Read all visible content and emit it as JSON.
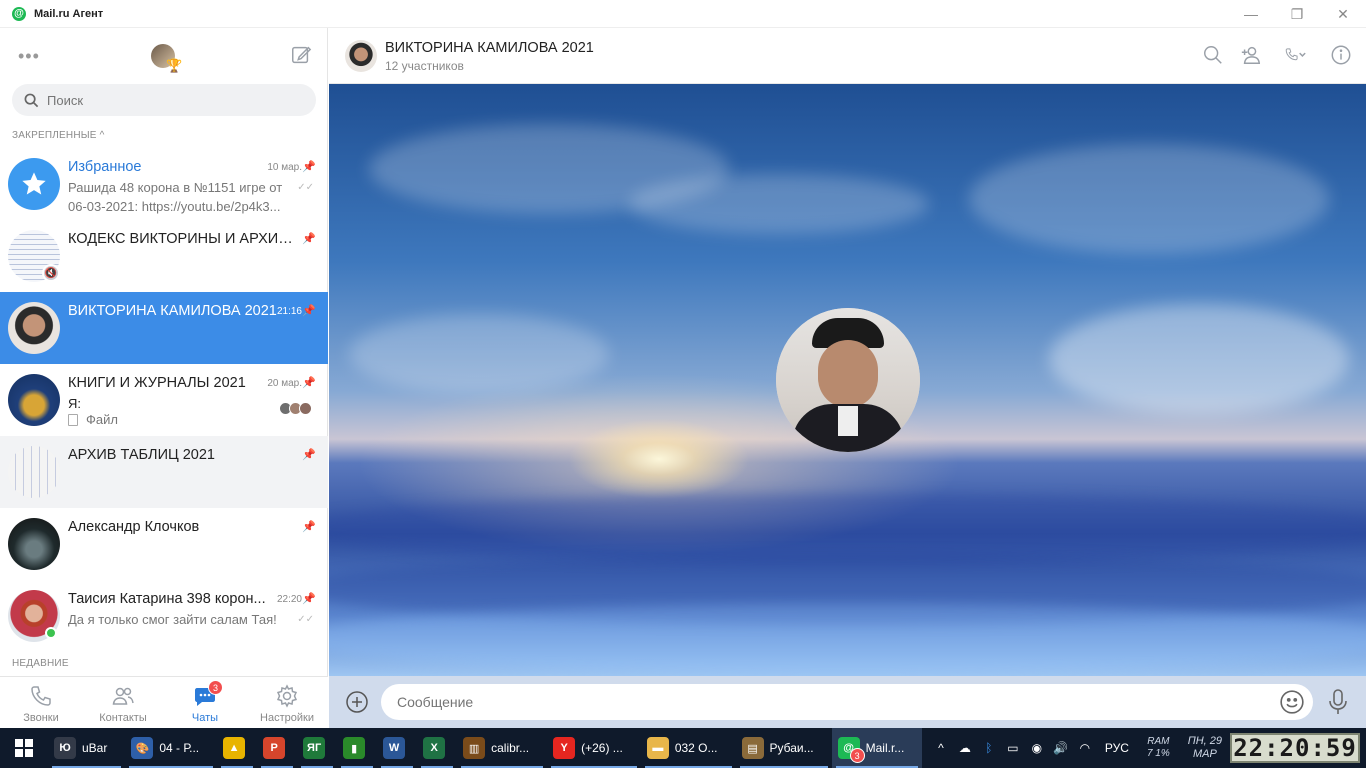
{
  "window": {
    "title": "Mail.ru Агент",
    "controls": [
      "minimize",
      "restore",
      "close"
    ]
  },
  "sidebar": {
    "search_placeholder": "Поиск",
    "pinned_label": "ЗАКРЕПЛЕННЫЕ",
    "recent_label": "НЕДАВНИЕ",
    "chats": [
      {
        "name": "Избранное",
        "time": "10 мар.",
        "preview": "Рашида 48 корона в №1151 игре от 06-03-2021: https://youtu.be/2p4k3..."
      },
      {
        "name": "КОДЕКС ВИКТОРИНЫ И АРХИВ ...",
        "time": "",
        "preview": ""
      },
      {
        "name": "ВИКТОРИНА КАМИЛОВА 2021",
        "time": "21:16",
        "preview": ""
      },
      {
        "name": "КНИГИ И ЖУРНАЛЫ 2021",
        "time": "20 мар.",
        "preview": "Я:",
        "file_label": "Файл"
      },
      {
        "name": "АРХИВ ТАБЛИЦ 2021",
        "time": "",
        "preview": ""
      },
      {
        "name": "Александр Клочков",
        "time": "",
        "preview": ""
      },
      {
        "name": "Таисия Катарина 398 корон...",
        "time": "22:20",
        "preview": "Да я только смог зайти салам Тая!"
      }
    ],
    "tabs": [
      {
        "label": "Звонки"
      },
      {
        "label": "Контакты"
      },
      {
        "label": "Чаты",
        "badge": "3"
      },
      {
        "label": "Настройки"
      }
    ]
  },
  "chat": {
    "title": "ВИКТОРИНА КАМИЛОВА 2021",
    "subtitle": "12 участников",
    "message_placeholder": "Сообщение"
  },
  "taskbar": {
    "items": [
      {
        "label": "uBar",
        "icon_text": "Ю",
        "color": "#333a48"
      },
      {
        "label": "04 - Р...",
        "icon_text": "🎨",
        "color": "#2e5fa8"
      },
      {
        "label": "",
        "icon_text": "▲",
        "color": "#e8b400"
      },
      {
        "label": "",
        "icon_text": "Р",
        "color": "#d6452c"
      },
      {
        "label": "",
        "icon_text": "ЯГ",
        "color": "#1f7a3a"
      },
      {
        "label": "",
        "icon_text": "▮",
        "color": "#2a8a2a"
      },
      {
        "label": "",
        "icon_text": "W",
        "color": "#2b5797"
      },
      {
        "label": "",
        "icon_text": "X",
        "color": "#1f7244"
      },
      {
        "label": "calibr...",
        "icon_text": "▥",
        "color": "#7a4b1a"
      },
      {
        "label": "(+26) ...",
        "icon_text": "Y",
        "color": "#e52620"
      },
      {
        "label": "032 О...",
        "icon_text": "▬",
        "color": "#e8b64a"
      },
      {
        "label": "Рубаи...",
        "icon_text": "▤",
        "color": "#8a6a3a"
      },
      {
        "label": "Mail.r...",
        "icon_text": "@",
        "color": "#1db954",
        "badge": "3"
      }
    ],
    "language": "РУС",
    "ram_label": "RAM",
    "ram_value": "7 1%",
    "day": "ПН, 29",
    "month": "МАР",
    "clock": "22:20:59"
  },
  "colors": {
    "accent": "#3c8ce7",
    "link": "#2a7ad8",
    "badge": "#f24e4e",
    "online": "#3cc34f"
  }
}
